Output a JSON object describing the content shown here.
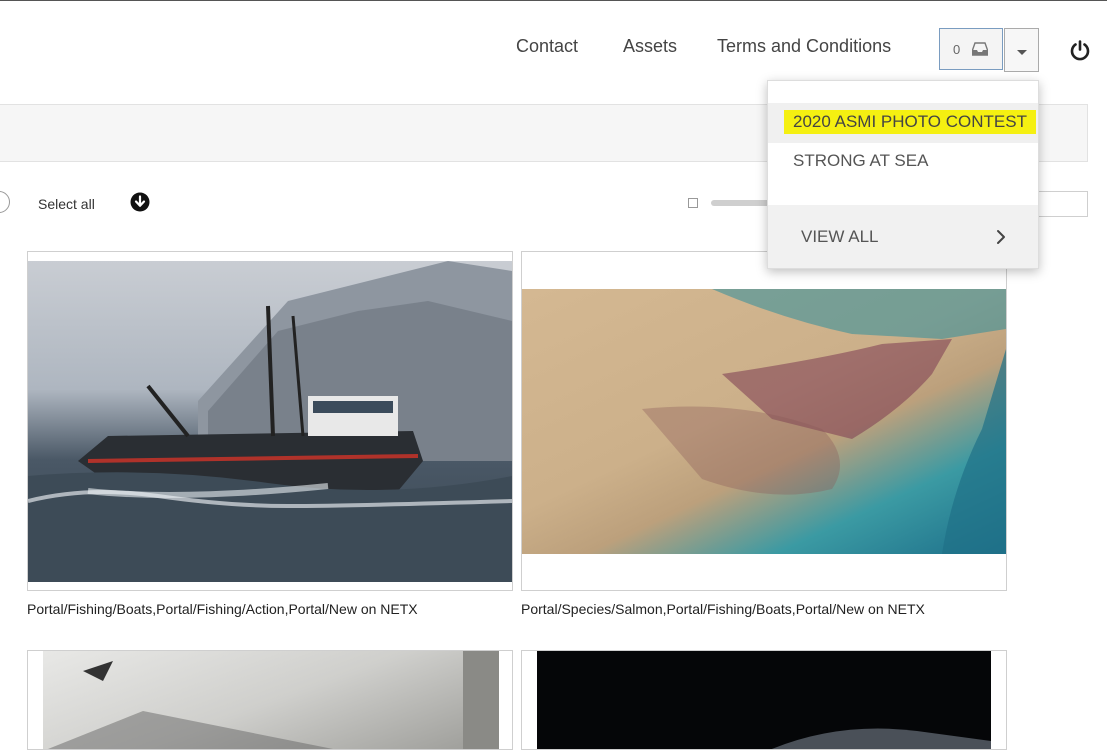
{
  "header": {
    "nav": [
      "Contact",
      "Assets",
      "Terms and Conditions"
    ],
    "cart_count": "0"
  },
  "toolbar": {
    "select_all": "Select all"
  },
  "assets": [
    {
      "caption": "Portal/Fishing/Boats,Portal/Fishing/Action,Portal/New on NETX"
    },
    {
      "caption": "Portal/Species/Salmon,Portal/Fishing/Boats,Portal/New on NETX"
    }
  ],
  "dropdown": {
    "items": [
      "2020 ASMI PHOTO CONTEST",
      "STRONG AT SEA"
    ],
    "view_all": "VIEW ALL",
    "highlight_color": "#f5f011"
  },
  "colors": {
    "accent_border": "#7a9cc0",
    "highlight": "#f5f011"
  }
}
